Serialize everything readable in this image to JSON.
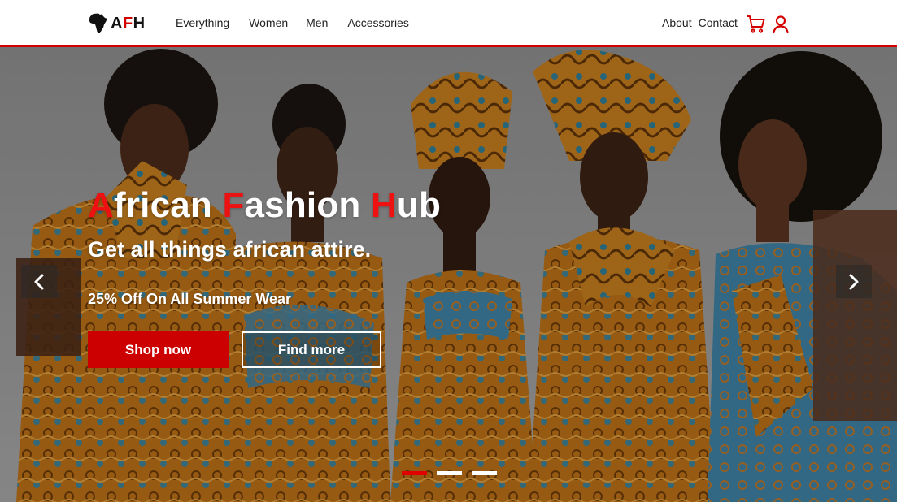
{
  "brand": {
    "logo_prefix": "A",
    "logo_accent": "F",
    "logo_suffix": "H",
    "icon": "africa-map-icon"
  },
  "nav": {
    "left": [
      {
        "label": "Everything"
      },
      {
        "label": "Women"
      },
      {
        "label": "Men"
      },
      {
        "label": "Accessories"
      }
    ],
    "right": [
      {
        "label": "About"
      },
      {
        "label": "Contact"
      }
    ],
    "icons": [
      "cart-icon",
      "user-icon"
    ]
  },
  "hero": {
    "title_parts": [
      {
        "cap": "A",
        "rest": "frican "
      },
      {
        "cap": "F",
        "rest": "ashion "
      },
      {
        "cap": "H",
        "rest": "ub"
      }
    ],
    "subtitle": "Get all things african attire.",
    "promo": "25% Off On All Summer Wear",
    "primary_button": "Shop now",
    "secondary_button": "Find more",
    "slides_total": 3,
    "active_slide": 1
  },
  "colors": {
    "accent": "#d40000",
    "text": "#222222",
    "white": "#ffffff"
  }
}
